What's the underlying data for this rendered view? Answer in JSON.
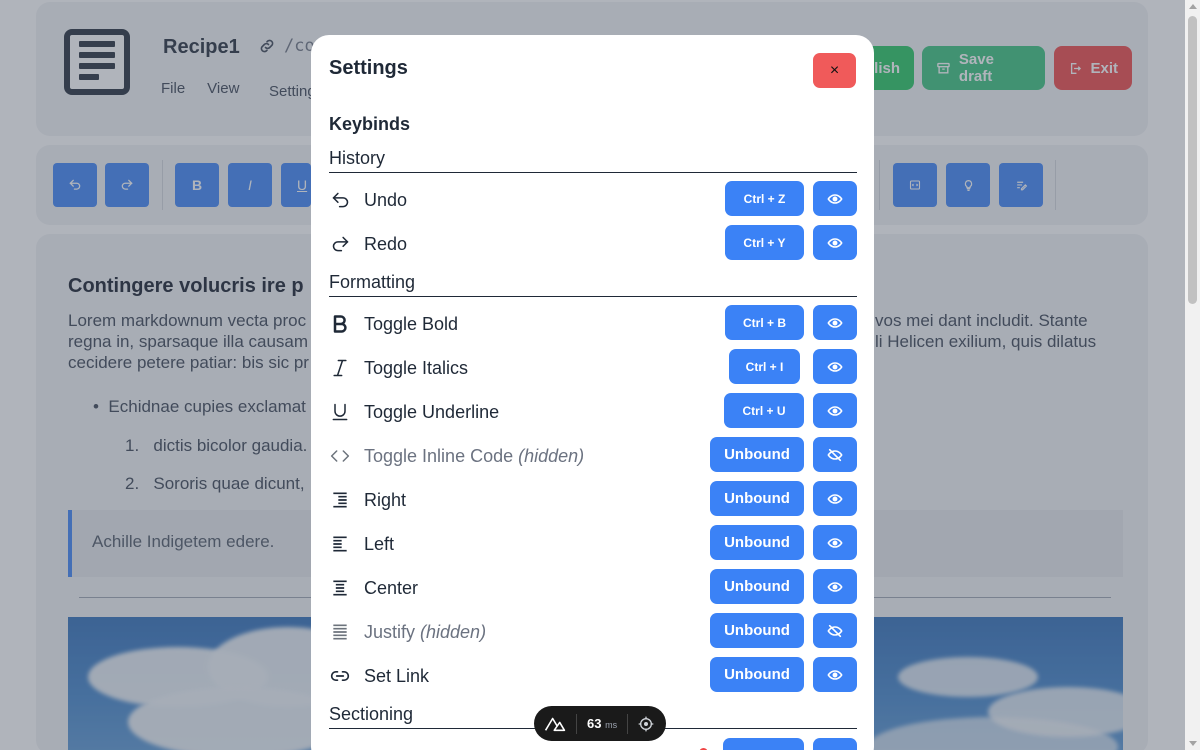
{
  "app": {
    "title": "Recipe1",
    "path": "/co",
    "menu": [
      "File",
      "View",
      "Setting"
    ],
    "header_buttons": {
      "publish": "lish",
      "save_draft": "Save draft",
      "exit": "Exit"
    }
  },
  "document": {
    "heading": "Contingere volucris ire p",
    "para_left": [
      "Lorem markdownum vecta proc",
      "regna in, sparsaque illa causam",
      "cecidere petere patiar: bis sic pr"
    ],
    "para_right": [
      "vos mei dant includit. Stante",
      "li Helicen exilium, quis dilatus"
    ],
    "bullet": "Echidnae cupies exclamat",
    "list_items": [
      "dictis bicolor gaudia.",
      "Sororis quae dicunt,"
    ],
    "list_numbers": [
      "1.",
      "2."
    ],
    "quote": "Achille Indigetem edere."
  },
  "modal": {
    "title": "Settings",
    "close": "×",
    "section": "Keybinds",
    "groups": {
      "history": "History",
      "formatting": "Formatting",
      "sectioning": "Sectioning"
    },
    "rows": [
      {
        "label": "Undo",
        "hidden_tag": "",
        "key": "Ctrl + Z",
        "visible": true
      },
      {
        "label": "Redo",
        "hidden_tag": "",
        "key": "Ctrl + Y",
        "visible": true
      },
      {
        "label": "Toggle Bold",
        "hidden_tag": "",
        "key": "Ctrl + B",
        "visible": true
      },
      {
        "label": "Toggle Italics",
        "hidden_tag": "",
        "key": "Ctrl + I",
        "visible": true
      },
      {
        "label": "Toggle Underline",
        "hidden_tag": "",
        "key": "Ctrl + U",
        "visible": true
      },
      {
        "label": "Toggle Inline Code ",
        "hidden_tag": "(hidden)",
        "key": "Unbound",
        "visible": false
      },
      {
        "label": "Right",
        "hidden_tag": "",
        "key": "Unbound",
        "visible": true
      },
      {
        "label": "Left",
        "hidden_tag": "",
        "key": "Unbound",
        "visible": true
      },
      {
        "label": "Center",
        "hidden_tag": "",
        "key": "Unbound",
        "visible": true
      },
      {
        "label": "Justify ",
        "hidden_tag": "(hidden)",
        "key": "Unbound",
        "visible": false
      },
      {
        "label": "Set Link",
        "hidden_tag": "",
        "key": "Unbound",
        "visible": true
      }
    ]
  },
  "devtools": {
    "ms_value": "63",
    "ms_unit": "ms"
  },
  "colors": {
    "accent": "#3b82f6",
    "danger": "#ef4444",
    "success": "#22c55e",
    "text": "#1f2937"
  }
}
